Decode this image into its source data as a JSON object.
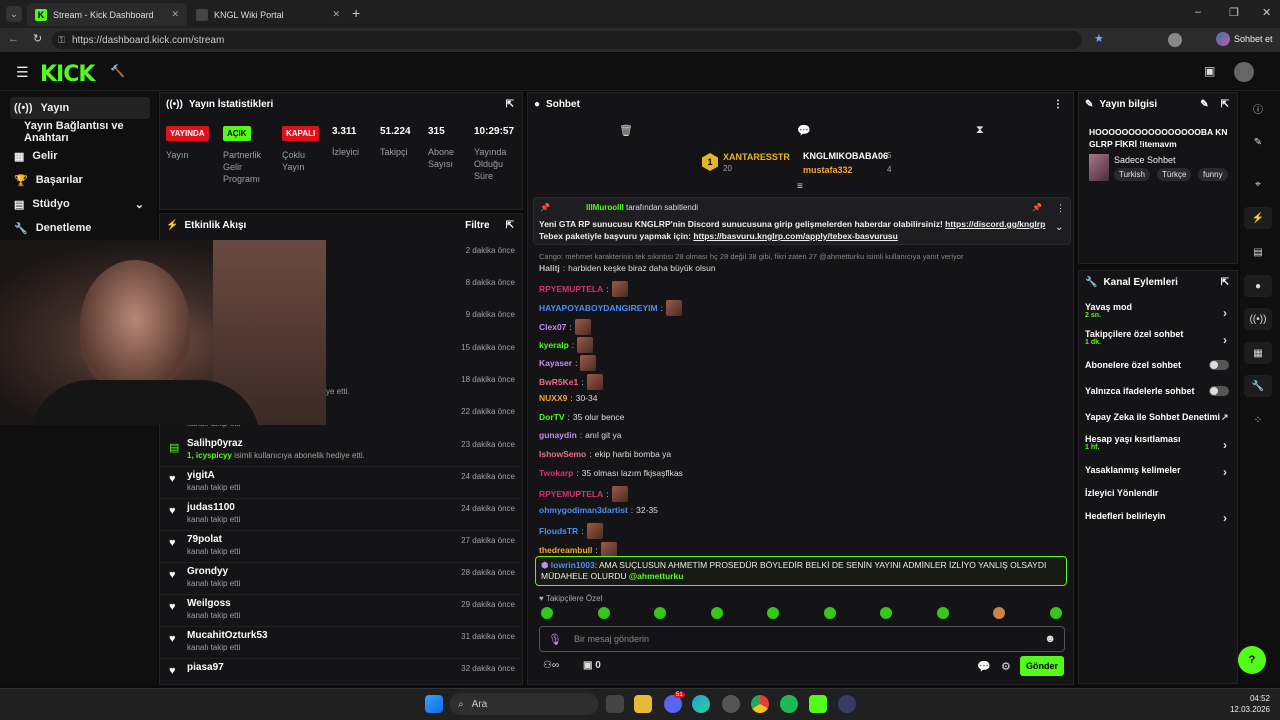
{
  "browser": {
    "tabs": [
      {
        "title": "Stream - Kick Dashboard"
      },
      {
        "title": "KNGL Wiki Portal"
      }
    ],
    "url": "https://dashboard.kick.com/stream",
    "copilot": "Sohbet et"
  },
  "leftnav": {
    "items": [
      {
        "label": "Yayın"
      },
      {
        "label": "Yayın Bağlantısı ve Anahtarı"
      },
      {
        "label": "Gelir"
      },
      {
        "label": "Başarılar"
      },
      {
        "label": "Stüdyo"
      },
      {
        "label": "Denetleme"
      }
    ]
  },
  "stats": {
    "title": "Yayın İstatistikleri",
    "badges": {
      "live": "YAYINDA",
      "partner": "AÇIK",
      "multi": "KAPALI"
    },
    "labels": {
      "stream": "Yayın",
      "partner": "Partnerlik Gelir Programı",
      "multi": "Çoklu Yayın",
      "viewers": "İzleyici",
      "followers": "Takipçi",
      "subs": "Abone Sayısı",
      "uptime": "Yayında Olduğu Süre"
    },
    "values": {
      "viewers": "3.311",
      "followers": "51.224",
      "subs": "315",
      "uptime": "10:29:57"
    }
  },
  "activity": {
    "title": "Etkinlik Akışı",
    "filter": "Filtre",
    "times_top": [
      "2 dakika önce",
      "8 dakika önce",
      "9 dakika önce",
      "15 dakika önce",
      "18 dakika önce",
      "22 dakika önce"
    ],
    "partial1": "ye etti.",
    "partial2": "kanalı takip etti",
    "rows": [
      {
        "name": "Salihp0yraz",
        "sub_user": "1, icyspicyy",
        "sub": " isimli kullanıcıya abonelik hediye etti.",
        "time": "23 dakika önce"
      },
      {
        "name": "yigitA",
        "sub": "kanalı takip etti",
        "time": "24 dakika önce"
      },
      {
        "name": "judas1100",
        "sub": "kanalı takip etti",
        "time": "24 dakika önce"
      },
      {
        "name": "79polat",
        "sub": "kanalı takip etti",
        "time": "27 dakika önce"
      },
      {
        "name": "Grondyy",
        "sub": "kanalı takip etti",
        "time": "28 dakika önce"
      },
      {
        "name": "Weilgoss",
        "sub": "kanalı takip etti",
        "time": "29 dakika önce"
      },
      {
        "name": "MucahitOzturk53",
        "sub": "kanalı takip etti",
        "time": "31 dakika önce"
      },
      {
        "name": "piasa97",
        "sub": "",
        "time": "32 dakika önce"
      }
    ]
  },
  "chat": {
    "title": "Sohbet",
    "top": {
      "first": "XANTARESSTR",
      "first_n": "20",
      "second": "KNGLMIKOBABA06",
      "second_n": "5",
      "third": "mustafa332",
      "third_n": "4"
    },
    "pinned": {
      "by": "IllMuroolll",
      "by_suffix": "tarafından sabitlendi",
      "text": "Yeni GTA RP sunucusu KNGLRP'nin Discord sunucusuna girip gelişmelerden haberdar olabilirsiniz!",
      "link1": "https://discord.gg/knglrp",
      "text2": "Tebex paketiyle başvuru yapmak için:",
      "link2": "https://basvuru.knglrp.com/apply/tebex-basvurusu"
    },
    "reply_note": "Cango: mehmet karakterinin tek sıkıntısı 28 olması hç 28 değil 38 gibi, fikri zaten 27 @ahmetturku isimli kullanıcıya yanıt veriyor",
    "messages": [
      {
        "user": "Halitj",
        "color": "#c0c0c0",
        "text": "harbiden keşke biraz daha büyük olsun"
      },
      {
        "user": "RPYEMUPTELA",
        "color": "#d6336c",
        "text": ""
      },
      {
        "user": "HAYAPOYABOYDANGIREYIM",
        "color": "#4d8ef7",
        "text": ""
      },
      {
        "user": "Clex07",
        "color": "#c58cf2",
        "text": ""
      },
      {
        "user": "kyeralp",
        "color": "#53fc18",
        "text": ""
      },
      {
        "user": "Kayaser",
        "color": "#c58cf2",
        "text": ""
      },
      {
        "user": "BwR5Ke1",
        "color": "#f06a8a",
        "text": ""
      },
      {
        "user": "NUXX9",
        "color": "#f7a531",
        "text": "30-34"
      },
      {
        "user": "DorTV",
        "color": "#53fc18",
        "text": "35 olur bence"
      },
      {
        "user": "gunaydin",
        "color": "#c58cf2",
        "text": "anıl git ya"
      },
      {
        "user": "IshowSemo",
        "color": "#f06a8a",
        "text": "ekip harbi bomba ya"
      },
      {
        "user": "Twokarp",
        "color": "#d6336c",
        "text": "35 olması lazım fkjsaşflkas"
      },
      {
        "user": "RPYEMUPTELA",
        "color": "#d6336c",
        "text": ""
      },
      {
        "user": "ohmygodiman3dartist",
        "color": "#4d8ef7",
        "text": "32-35"
      },
      {
        "user": "FloudsTR",
        "color": "#4d8ef7",
        "text": ""
      },
      {
        "user": "thedreambull",
        "color": "#f7a531",
        "text": ""
      }
    ],
    "highlight": {
      "user": "lowrin1003",
      "text": "AMA SUÇLUSUN AHMETİM PROSEDÜR BÖYLEDİR BELKİ DE SENİN YAYINI ADMİNLER İZLİYO YANLIŞ OLSAYDI MÜDAHELE OLURDU",
      "mention": "@ahmetturku"
    },
    "followers_only": "Takipçilere Özel",
    "input_placeholder": "Bir mesaj gönderin",
    "send": "Gönder",
    "count": "0"
  },
  "info": {
    "title": "Yayın bilgisi",
    "stream_title": "HOOOOOOOOOOOOOOOOBA KNGLRP FİKRİ !itemavm",
    "category": "Sadece Sohbet",
    "tags": [
      "Turkish",
      "Türkçe",
      "funny"
    ]
  },
  "actions": {
    "title": "Kanal Eylemleri",
    "items": [
      {
        "label": "Yavaş mod",
        "sub": "2 sn."
      },
      {
        "label": "Takipçilere özel sohbet",
        "sub": "1 dk."
      },
      {
        "label": "Abonelere özel sohbet",
        "sub": ""
      },
      {
        "label": "Yalnızca ifadelerle sohbet",
        "sub": ""
      },
      {
        "label": "Yapay Zeka ile Sohbet Denetimi",
        "sub": ""
      },
      {
        "label": "Hesap yaşı kısıtlaması",
        "sub": "1 hf."
      },
      {
        "label": "Yasaklanmış kelimeler",
        "sub": ""
      },
      {
        "label": "İzleyici Yönlendir",
        "sub": ""
      },
      {
        "label": "Hedefleri belirleyin",
        "sub": ""
      }
    ]
  },
  "taskbar": {
    "search": "Ara",
    "time": "04:52",
    "date": "12.03.2026",
    "badge": "51"
  },
  "colors": {
    "accent": "#53fc18",
    "live": "#e0111b"
  }
}
